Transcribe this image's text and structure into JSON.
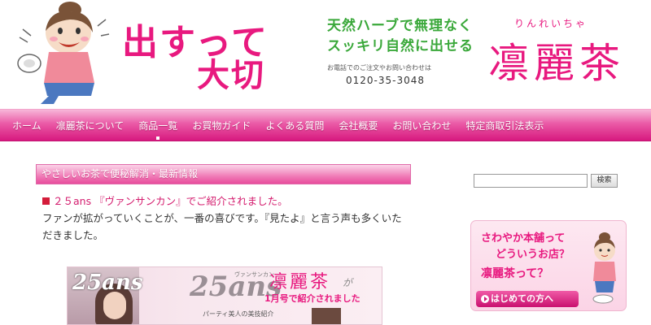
{
  "header": {
    "slogan_line1": "出すって",
    "slogan_line2": "大切",
    "copy_line1": "天然ハーブで無理なく",
    "copy_line2": "スッキリ自然に出せる",
    "tel_note": "お電話でのご注文やお問い合わせは",
    "tel_number": "0120-35-3048",
    "brand_ruby": "りんれいちゃ",
    "brand_name": "凛麗茶"
  },
  "nav": {
    "items": [
      {
        "label": "ホーム"
      },
      {
        "label": "凛麗茶について"
      },
      {
        "label": "商品一覧"
      },
      {
        "label": "お買物ガイド"
      },
      {
        "label": "よくある質問"
      },
      {
        "label": "会社概要"
      },
      {
        "label": "お問い合わせ"
      },
      {
        "label": "特定商取引法表示"
      }
    ],
    "active_index": 2
  },
  "main": {
    "section_title": "やさしいお茶で便秘解消・最新情報",
    "news_headline": "２５ans 『ヴァンサンカン』でご紹介されました。",
    "news_body": "ファンが拡がっていくことが、一番の喜びです。『見たよ』と言う声も多くいただきました。",
    "magazine": {
      "logo": "25ans",
      "big_title": "25ans",
      "ruby": "ヴァンサンカン",
      "brand": "凛麗茶",
      "ga": "が",
      "featured": "1月号で紹介されました",
      "party": "パーティ美人の美技紹介"
    }
  },
  "sidebar": {
    "search_placeholder": "",
    "search_button": "検索",
    "promo_line1": "さわやか本舗って",
    "promo_line2": "どういうお店？",
    "promo_line3": "凛麗茶って？",
    "promo_button": "はじめての方へ"
  },
  "colors": {
    "brand_pink": "#e8197f",
    "copy_green": "#3aa83a",
    "nav_pink": "#d7197f"
  }
}
